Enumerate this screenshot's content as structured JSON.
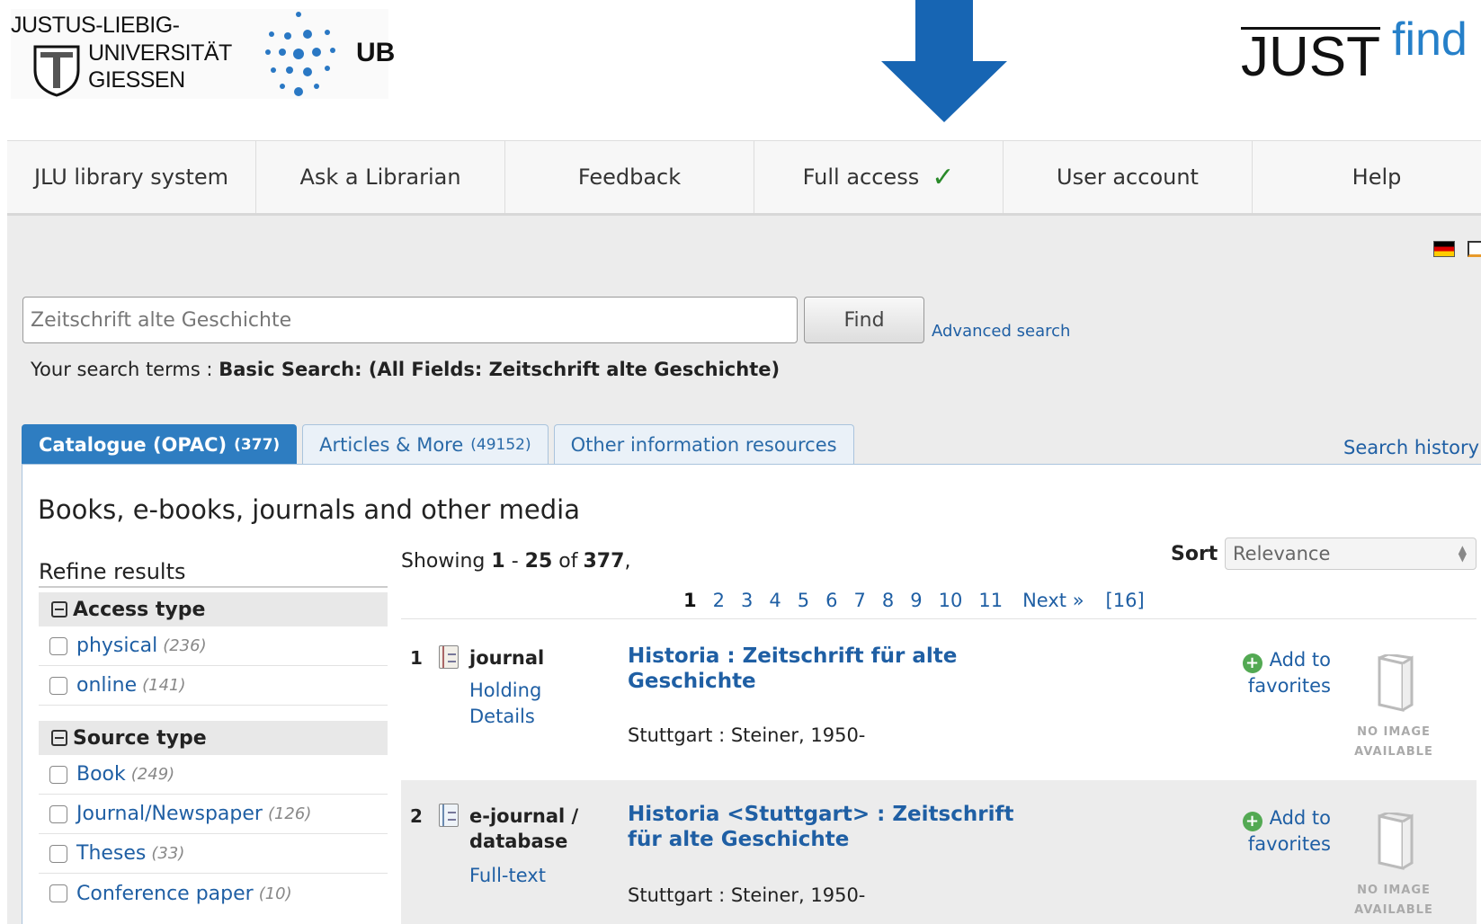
{
  "header": {
    "logo": {
      "line1": "JUSTUS-LIEBIG-",
      "line2": "UNIVERSITÄT",
      "line3": "GIESSEN",
      "ub": "UB"
    },
    "brand": {
      "just": "JUST",
      "find": "find"
    },
    "arrow_color": "#1765b3"
  },
  "nav": {
    "items": [
      {
        "label": "JLU library system"
      },
      {
        "label": "Ask a Librarian"
      },
      {
        "label": "Feedback"
      },
      {
        "label": "Full access",
        "check": "✓"
      },
      {
        "label": "User account"
      },
      {
        "label": "Help"
      }
    ]
  },
  "search": {
    "value": "Zeitschrift alte Geschichte",
    "find_label": "Find",
    "advanced_label": "Advanced search",
    "terms_label": "Your search terms :",
    "terms_value": "Basic Search: (All Fields: Zeitschrift alte Geschichte)"
  },
  "tabs": [
    {
      "label": "Catalogue (OPAC)",
      "count": "(377)",
      "active": true
    },
    {
      "label": "Articles & More",
      "count": "(49152)"
    },
    {
      "label": "Other information resources",
      "count": ""
    }
  ],
  "search_history": "Search history",
  "panel_title": "Books, e-books, journals and other media",
  "refine": {
    "title": "Refine results",
    "facets": [
      {
        "title": "Access type",
        "items": [
          {
            "label": "physical",
            "count": "(236)"
          },
          {
            "label": "online",
            "count": "(141)"
          }
        ]
      },
      {
        "title": "Source type",
        "items": [
          {
            "label": "Book",
            "count": "(249)"
          },
          {
            "label": "Journal/Newspaper",
            "count": "(126)"
          },
          {
            "label": "Theses",
            "count": "(33)"
          },
          {
            "label": "Conference paper",
            "count": "(10)"
          }
        ]
      }
    ]
  },
  "results_info": {
    "showing": "Showing",
    "from": "1",
    "dash": "-",
    "to": "25",
    "of": "of",
    "total": "377",
    "comma": ","
  },
  "sort": {
    "label": "Sort",
    "value": "Relevance"
  },
  "pager": {
    "pages": [
      "1",
      "2",
      "3",
      "4",
      "5",
      "6",
      "7",
      "8",
      "9",
      "10",
      "11"
    ],
    "current": "1",
    "next": "Next »",
    "last": "[16]"
  },
  "results": [
    {
      "num": "1",
      "type": "journal",
      "links": [
        "Holding",
        "Details"
      ],
      "title": "Historia : Zeitschrift für alte Geschichte",
      "publisher": "Stuttgart : Steiner, 1950-",
      "fav": "Add to favorites",
      "noimage": [
        "NO IMAGE",
        "AVAILABLE"
      ]
    },
    {
      "num": "2",
      "type": "e-journal / database",
      "links": [
        "Full-text"
      ],
      "title": "Historia <Stuttgart> : Zeitschrift für alte Geschichte",
      "publisher": "Stuttgart : Steiner, 1950-",
      "fav": "Add to favorites",
      "noimage": [
        "NO IMAGE",
        "AVAILABLE"
      ]
    }
  ]
}
